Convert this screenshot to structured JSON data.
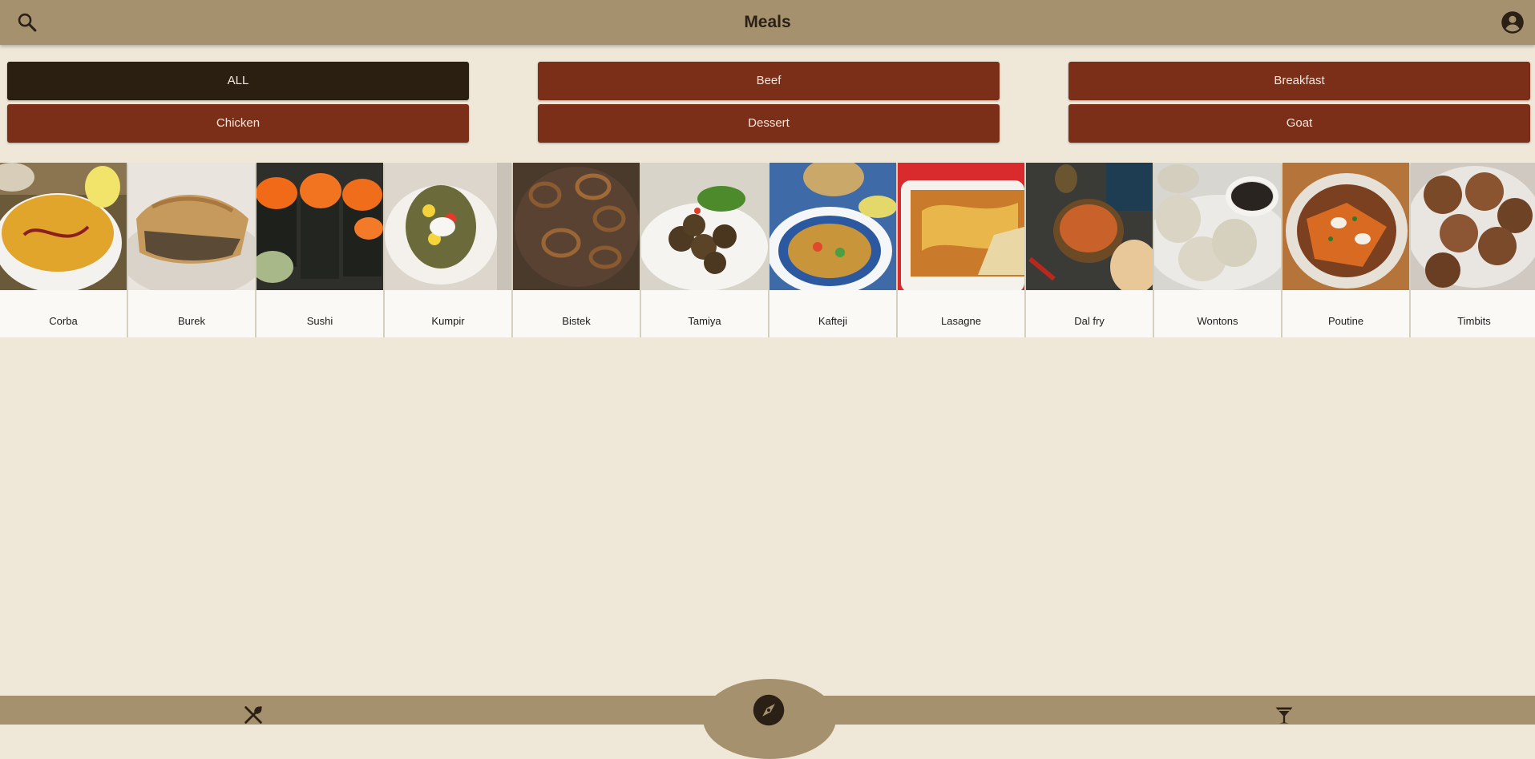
{
  "header": {
    "title": "Meals",
    "search_icon": "search-icon",
    "account_icon": "account-circle-icon"
  },
  "categories": [
    {
      "label": "ALL",
      "active": true
    },
    {
      "label": "Beef",
      "active": false
    },
    {
      "label": "Breakfast",
      "active": false
    },
    {
      "label": "Chicken",
      "active": false
    },
    {
      "label": "Dessert",
      "active": false
    },
    {
      "label": "Goat",
      "active": false
    }
  ],
  "meals": [
    {
      "name": "Corba"
    },
    {
      "name": "Burek"
    },
    {
      "name": "Sushi"
    },
    {
      "name": "Kumpir"
    },
    {
      "name": "Bistek"
    },
    {
      "name": "Tamiya"
    },
    {
      "name": "Kafteji"
    },
    {
      "name": "Lasagne"
    },
    {
      "name": "Dal fry"
    },
    {
      "name": "Wontons"
    },
    {
      "name": "Poutine"
    },
    {
      "name": "Timbits"
    }
  ],
  "bottom_nav": {
    "meals_icon": "fork-spoon-icon",
    "explore_icon": "compass-icon",
    "drinks_icon": "cocktail-icon"
  },
  "colors": {
    "bar": "#a5916d",
    "background": "#efe7d7",
    "category": "#7b2f19",
    "category_active": "#2b1f12"
  }
}
